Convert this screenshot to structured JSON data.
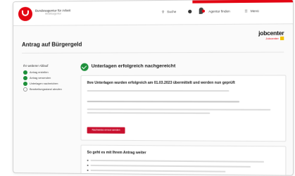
{
  "header": {
    "brand_line1": "Bundesagentur für Arbeit",
    "brand_line2": "Arbeitsagentur",
    "nav": {
      "search": "Suche",
      "location": "Agentur finden",
      "menu": "Menü"
    }
  },
  "page": {
    "title": "Antrag auf Bürgergeld",
    "partner_logo": "jobcenter",
    "partner_sub": "Jobcenter"
  },
  "steps": {
    "title": "Ihr weiterer Ablauf",
    "items": [
      {
        "label": "Antrag erstellen",
        "done": true
      },
      {
        "label": "Antrag versenden",
        "done": true
      },
      {
        "label": "Unterlagen nachreichen",
        "done": true
      },
      {
        "label": "Bearbeitungsstand abrufen",
        "done": false
      }
    ]
  },
  "success": {
    "title": "Unterlagen erfolgreich nachgereicht"
  },
  "box1": {
    "heading": "Ihre Unterlagen wurden erfolgreich am 01.03.2023 übermittelt und werden nun geprüft",
    "button": "Nachweise erneut senden"
  },
  "box2": {
    "heading": "So geht es mit Ihrem Antrag weiter"
  },
  "colors": {
    "brand_red": "#e30613",
    "success_green": "#1d8f3a",
    "button_red": "#c8102e"
  },
  "icons": [
    "search-icon",
    "location-pin-icon",
    "menu-icon",
    "check-circle-icon"
  ]
}
